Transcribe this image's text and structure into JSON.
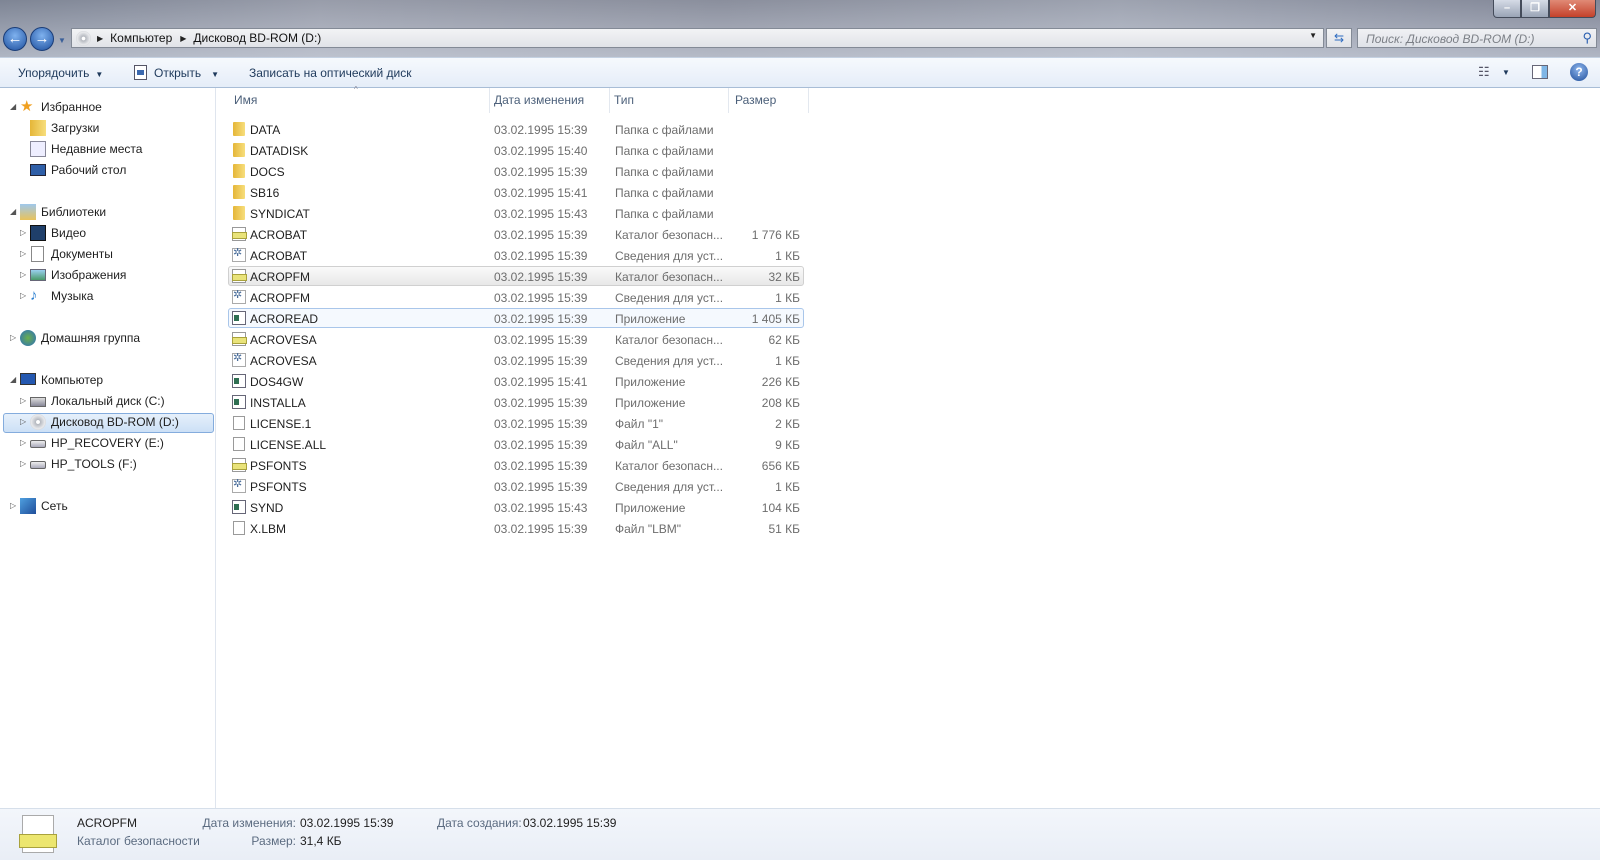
{
  "window": {
    "minimize": "–",
    "maximize": "❐",
    "close": "✕"
  },
  "address": {
    "crumbs": [
      "Компьютер",
      "Дисковод BD-ROM (D:)"
    ]
  },
  "search": {
    "placeholder": "Поиск: Дисковод BD-ROM (D:)"
  },
  "toolbar": {
    "organize": "Упорядочить",
    "open": "Открыть",
    "burn": "Записать на оптический диск"
  },
  "sidebar": {
    "favorites": {
      "label": "Избранное",
      "items": [
        "Загрузки",
        "Недавние места",
        "Рабочий стол"
      ]
    },
    "libraries": {
      "label": "Библиотеки",
      "items": [
        "Видео",
        "Документы",
        "Изображения",
        "Музыка"
      ]
    },
    "homegroup": {
      "label": "Домашняя группа"
    },
    "computer": {
      "label": "Компьютер",
      "items": [
        "Локальный диск (C:)",
        "Дисковод BD-ROM (D:)",
        "HP_RECOVERY (E:)",
        "HP_TOOLS (F:)"
      ],
      "selected": "Дисковод BD-ROM (D:)"
    },
    "network": {
      "label": "Сеть"
    }
  },
  "columns": {
    "name": "Имя",
    "date": "Дата изменения",
    "type": "Тип",
    "size": "Размер"
  },
  "files": [
    {
      "icon": "folder",
      "name": "DATA",
      "date": "03.02.1995 15:39",
      "type": "Папка с файлами",
      "size": ""
    },
    {
      "icon": "folder",
      "name": "DATADISK",
      "date": "03.02.1995 15:40",
      "type": "Папка с файлами",
      "size": ""
    },
    {
      "icon": "folder",
      "name": "DOCS",
      "date": "03.02.1995 15:39",
      "type": "Папка с файлами",
      "size": ""
    },
    {
      "icon": "folder",
      "name": "SB16",
      "date": "03.02.1995 15:41",
      "type": "Папка с файлами",
      "size": ""
    },
    {
      "icon": "folder",
      "name": "SYNDICAT",
      "date": "03.02.1995 15:43",
      "type": "Папка с файлами",
      "size": ""
    },
    {
      "icon": "cat",
      "name": "ACROBAT",
      "date": "03.02.1995 15:39",
      "type": "Каталог безопасн...",
      "size": "1 776 КБ"
    },
    {
      "icon": "inf",
      "name": "ACROBAT",
      "date": "03.02.1995 15:39",
      "type": "Сведения для уст...",
      "size": "1 КБ"
    },
    {
      "icon": "cat",
      "name": "ACROPFM",
      "date": "03.02.1995 15:39",
      "type": "Каталог безопасн...",
      "size": "32 КБ",
      "state": "hover"
    },
    {
      "icon": "inf",
      "name": "ACROPFM",
      "date": "03.02.1995 15:39",
      "type": "Сведения для уст...",
      "size": "1 КБ"
    },
    {
      "icon": "app",
      "name": "ACROREAD",
      "date": "03.02.1995 15:39",
      "type": "Приложение",
      "size": "1 405 КБ",
      "state": "focus"
    },
    {
      "icon": "cat",
      "name": "ACROVESA",
      "date": "03.02.1995 15:39",
      "type": "Каталог безопасн...",
      "size": "62 КБ"
    },
    {
      "icon": "inf",
      "name": "ACROVESA",
      "date": "03.02.1995 15:39",
      "type": "Сведения для уст...",
      "size": "1 КБ"
    },
    {
      "icon": "app",
      "name": "DOS4GW",
      "date": "03.02.1995 15:41",
      "type": "Приложение",
      "size": "226 КБ"
    },
    {
      "icon": "app",
      "name": "INSTALLA",
      "date": "03.02.1995 15:39",
      "type": "Приложение",
      "size": "208 КБ"
    },
    {
      "icon": "file",
      "name": "LICENSE.1",
      "date": "03.02.1995 15:39",
      "type": "Файл \"1\"",
      "size": "2 КБ"
    },
    {
      "icon": "file",
      "name": "LICENSE.ALL",
      "date": "03.02.1995 15:39",
      "type": "Файл \"ALL\"",
      "size": "9 КБ"
    },
    {
      "icon": "cat",
      "name": "PSFONTS",
      "date": "03.02.1995 15:39",
      "type": "Каталог безопасн...",
      "size": "656 КБ"
    },
    {
      "icon": "inf",
      "name": "PSFONTS",
      "date": "03.02.1995 15:39",
      "type": "Сведения для уст...",
      "size": "1 КБ"
    },
    {
      "icon": "app",
      "name": "SYND",
      "date": "03.02.1995 15:43",
      "type": "Приложение",
      "size": "104 КБ"
    },
    {
      "icon": "file",
      "name": "X.LBM",
      "date": "03.02.1995 15:39",
      "type": "Файл \"LBM\"",
      "size": "51 КБ"
    }
  ],
  "details": {
    "name": "ACROPFM",
    "type": "Каталог безопасности",
    "modified_label": "Дата изменения:",
    "modified": "03.02.1995 15:39",
    "created_label": "Дата создания:",
    "created": "03.02.1995 15:39",
    "size_label": "Размер:",
    "size": "31,4 КБ"
  }
}
